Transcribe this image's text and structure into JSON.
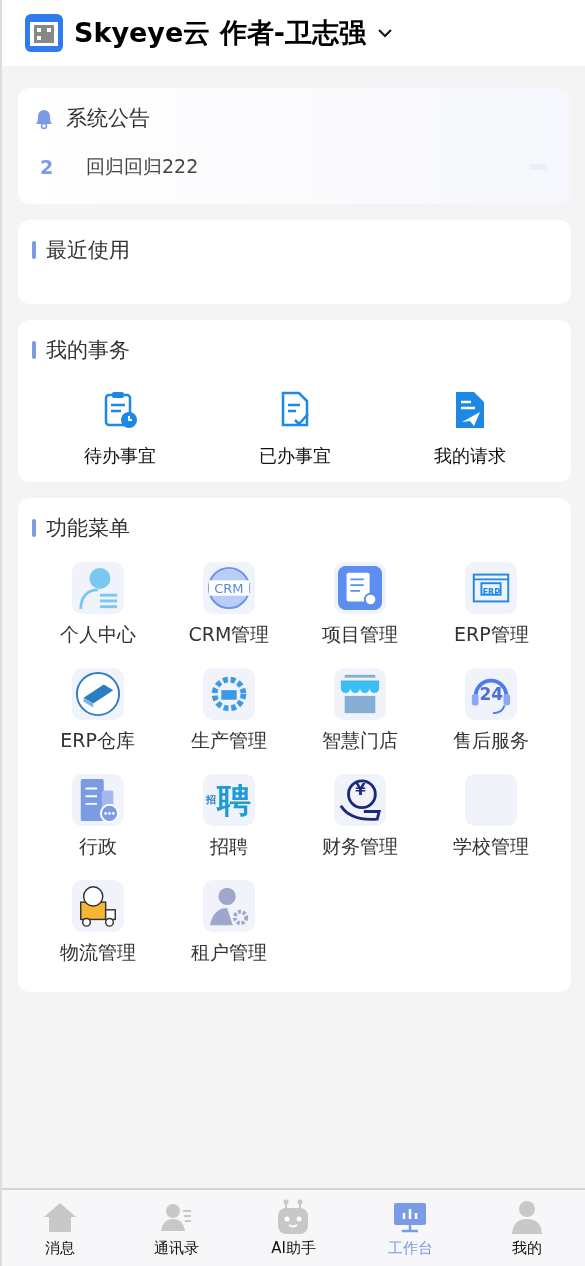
{
  "header": {
    "title": "Skyeye云 作者-卫志强"
  },
  "notice": {
    "title": "系统公告",
    "items": [
      {
        "number": "2",
        "text": "回归回归222"
      }
    ]
  },
  "recent": {
    "title": "最近使用"
  },
  "affairs": {
    "title": "我的事务",
    "items": [
      {
        "label": "待办事宜"
      },
      {
        "label": "已办事宜"
      },
      {
        "label": "我的请求"
      }
    ]
  },
  "menu": {
    "title": "功能菜单",
    "items": [
      {
        "label": "个人中心"
      },
      {
        "label": "CRM管理",
        "icon_text": [
          "CRM"
        ]
      },
      {
        "label": "项目管理"
      },
      {
        "label": "ERP管理",
        "icon_text": [
          "ERP"
        ]
      },
      {
        "label": "ERP仓库"
      },
      {
        "label": "生产管理"
      },
      {
        "label": "智慧门店"
      },
      {
        "label": "售后服务",
        "icon_text": [
          "24"
        ]
      },
      {
        "label": "行政"
      },
      {
        "label": "招聘",
        "icon_text": [
          "招",
          "聘"
        ]
      },
      {
        "label": "财务管理",
        "icon_text": [
          "¥"
        ]
      },
      {
        "label": "学校管理"
      },
      {
        "label": "物流管理"
      },
      {
        "label": "租户管理"
      }
    ]
  },
  "tab_bar": [
    {
      "label": "消息",
      "selected": false
    },
    {
      "label": "通讯录",
      "selected": false
    },
    {
      "label": "AI助手",
      "selected": false
    },
    {
      "label": "工作台",
      "selected": true
    },
    {
      "label": "我的",
      "selected": false
    }
  ]
}
